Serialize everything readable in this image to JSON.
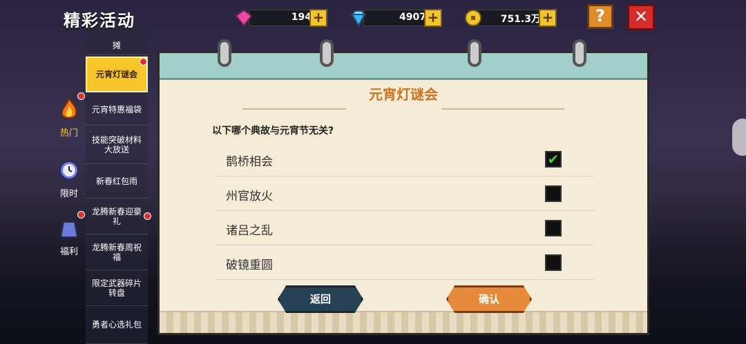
{
  "header": {
    "title": "精彩活动"
  },
  "resources": [
    {
      "name": "pink-gem",
      "value": "194",
      "color": "#e84aa6"
    },
    {
      "name": "blue-diamond",
      "value": "4907",
      "color": "#3ab4f0"
    },
    {
      "name": "gold-coin",
      "value": "751.3万",
      "color": "#f0c431"
    }
  ],
  "buttons": {
    "help": "?",
    "close": "✕",
    "back": "返回",
    "confirm": "确认"
  },
  "categories": [
    {
      "label": "热门",
      "icon": "flame-icon",
      "active": true,
      "badge": true
    },
    {
      "label": "限时",
      "icon": "clock-icon",
      "active": false,
      "badge": false
    },
    {
      "label": "福利",
      "icon": "gift-bag-icon",
      "active": false,
      "badge": true
    }
  ],
  "sidebar": {
    "items": [
      {
        "label": "摊"
      },
      {
        "label": "元宵灯谜会",
        "active": true
      },
      {
        "label": "元宵特惠福袋"
      },
      {
        "label": "技能突破材料大放送"
      },
      {
        "label": "新春红包雨"
      },
      {
        "label": "龙腾新春迎豪礼"
      },
      {
        "label": "龙腾新春周祝福"
      },
      {
        "label": "限定武器碎片转盘"
      },
      {
        "label": "勇者心选礼包"
      }
    ]
  },
  "quiz": {
    "title": "元宵灯谜会",
    "question": "以下哪个典故与元宵节无关?",
    "options": [
      {
        "label": "鹊桥相会",
        "checked": true
      },
      {
        "label": "州官放火",
        "checked": false
      },
      {
        "label": "诸吕之乱",
        "checked": false
      },
      {
        "label": "破镜重圆",
        "checked": false
      }
    ]
  }
}
